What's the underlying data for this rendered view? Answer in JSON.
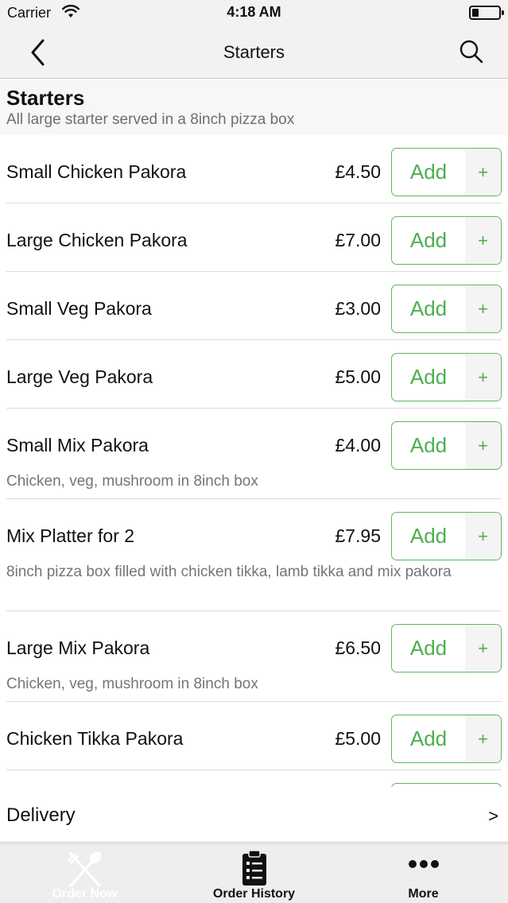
{
  "status_bar": {
    "carrier": "Carrier",
    "time": "4:18 AM"
  },
  "nav": {
    "title": "Starters"
  },
  "section": {
    "title": "Starters",
    "subtitle": "All large starter served in a 8inch pizza box"
  },
  "add_label": "Add",
  "plus_label": "+",
  "items": [
    {
      "name": "Small Chicken Pakora",
      "price": "£4.50",
      "desc": ""
    },
    {
      "name": "Large Chicken Pakora",
      "price": "£7.00",
      "desc": ""
    },
    {
      "name": "Small Veg Pakora",
      "price": "£3.00",
      "desc": ""
    },
    {
      "name": "Large Veg Pakora",
      "price": "£5.00",
      "desc": ""
    },
    {
      "name": "Small Mix Pakora",
      "price": "£4.00",
      "desc": "Chicken, veg, mushroom in 8inch box"
    },
    {
      "name": "Mix Platter for 2",
      "price": "£7.95",
      "desc": "8inch pizza box filled with chicken tikka, lamb tikka and mix pakora"
    },
    {
      "name": "Large Mix Pakora",
      "price": "£6.50",
      "desc": "Chicken, veg, mushroom in 8inch box"
    },
    {
      "name": "Chicken Tikka Pakora",
      "price": "£5.00",
      "desc": ""
    }
  ],
  "delivery": {
    "label": "Delivery",
    "chevron": ">"
  },
  "tabs": [
    {
      "label": "Order Now",
      "icon": "fork-knife-icon"
    },
    {
      "label": "Order History",
      "icon": "clipboard-list-icon"
    },
    {
      "label": "More",
      "icon": "more-dots-icon"
    }
  ],
  "colors": {
    "accent": "#4caf50",
    "accent_border": "#5cb85c",
    "bar_bg": "#f2f2f2"
  }
}
